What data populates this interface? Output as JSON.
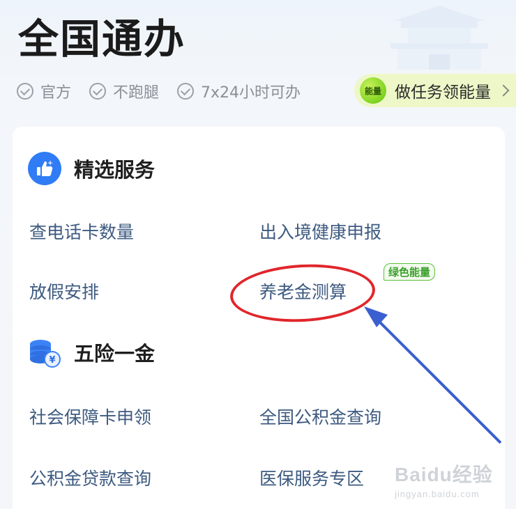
{
  "header": {
    "title": "全国通办"
  },
  "tags": [
    {
      "label": "官方"
    },
    {
      "label": "不跑腿"
    },
    {
      "label": "7x24小时可办"
    }
  ],
  "energy": {
    "badge": "能量",
    "text": "做任务领能量"
  },
  "sections": {
    "featured": {
      "title": "精选服务",
      "items": [
        "查电话卡数量",
        "出入境健康申报",
        "放假安排",
        "养老金测算"
      ]
    },
    "insurance": {
      "title": "五险一金",
      "items": [
        "社会保障卡申领",
        "全国公积金查询",
        "公积金贷款查询",
        "医保服务专区"
      ],
      "badge": "绿色能量"
    }
  },
  "annotation": {
    "highlight_color": "#e0262b",
    "arrow_color": "#3a5fd0"
  },
  "watermark": {
    "main": "Baidu经验",
    "sub": "jingyan.baidu.com"
  }
}
